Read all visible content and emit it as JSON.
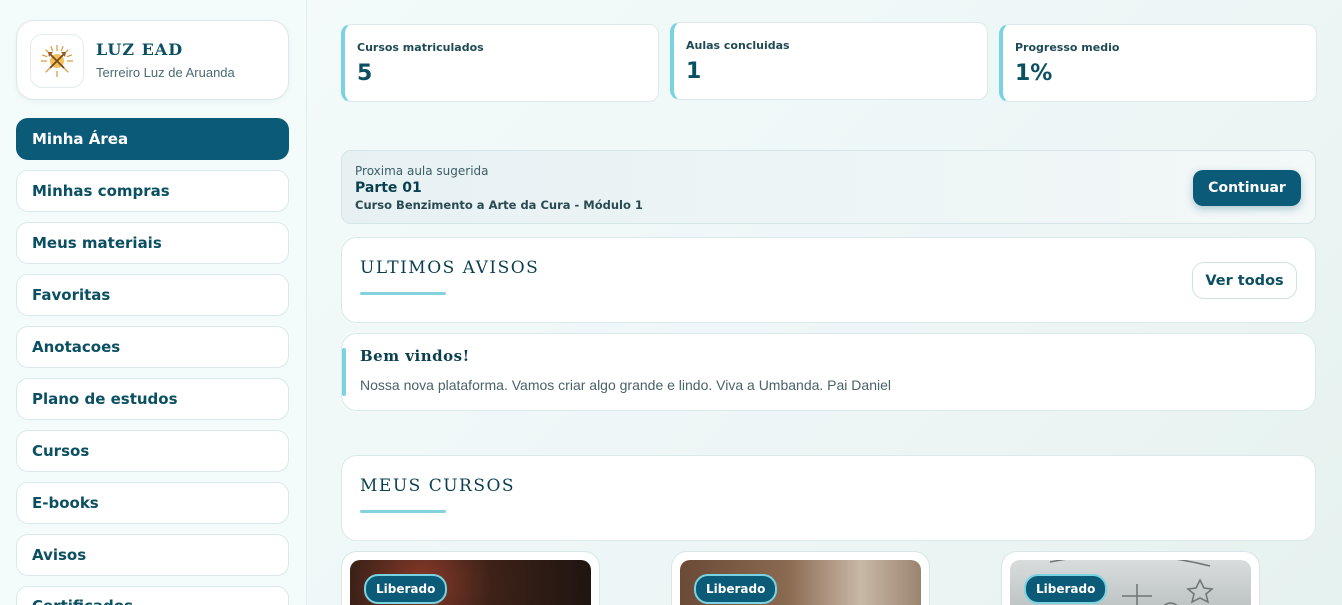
{
  "brand": {
    "title": "LUZ EAD",
    "subtitle": "Terreiro Luz de Aruanda",
    "logo_icon": "sun-axes-logo-icon"
  },
  "sidebar": {
    "items": [
      {
        "label": "Minha Área",
        "active": true
      },
      {
        "label": "Minhas compras",
        "active": false
      },
      {
        "label": "Meus materiais",
        "active": false
      },
      {
        "label": "Favoritas",
        "active": false
      },
      {
        "label": "Anotacoes",
        "active": false
      },
      {
        "label": "Plano de estudos",
        "active": false
      },
      {
        "label": "Cursos",
        "active": false
      },
      {
        "label": "E-books",
        "active": false
      },
      {
        "label": "Avisos",
        "active": false
      },
      {
        "label": "Certificados",
        "active": false
      }
    ]
  },
  "stats": [
    {
      "label": "Cursos matriculados",
      "value": "5"
    },
    {
      "label": "Aulas concluidas",
      "value": "1"
    },
    {
      "label": "Progresso medio",
      "value": "1%"
    }
  ],
  "next_lesson": {
    "label": "Proxima aula sugerida",
    "title": "Parte 01",
    "course": "Curso Benzimento a Arte da Cura - Módulo 1",
    "button": "Continuar"
  },
  "notices": {
    "title": "ULTIMOS AVISOS",
    "view_all": "Ver todos",
    "items": [
      {
        "title": "Bem vindos!",
        "body": "Nossa nova plataforma. Vamos criar algo grande e lindo. Viva a Umbanda. Pai Daniel"
      }
    ]
  },
  "courses": {
    "title": "MEUS CURSOS",
    "cards": [
      {
        "badge": "Liberado"
      },
      {
        "badge": "Liberado"
      },
      {
        "badge": "Liberado"
      }
    ]
  },
  "colors": {
    "primary": "#0a5a78",
    "accent": "#7ad3e0",
    "text": "#0b4f62"
  }
}
